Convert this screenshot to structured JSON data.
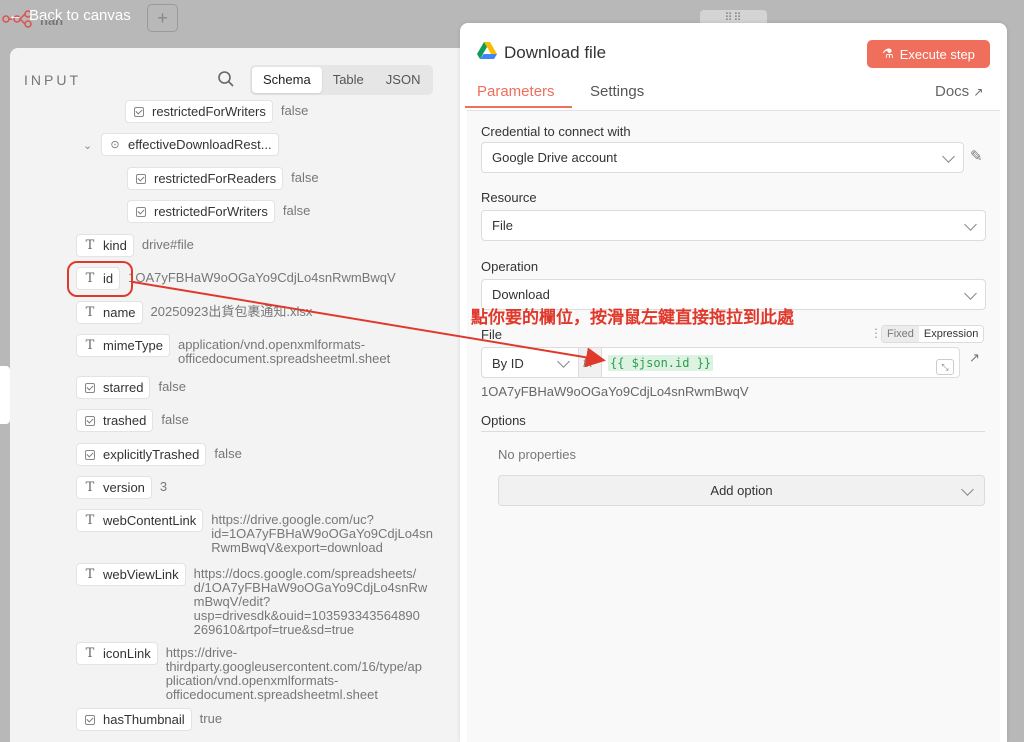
{
  "canvas": {
    "back_label": "Back to canvas",
    "plus_label": "+",
    "bg_label": "nan"
  },
  "input_panel": {
    "title": "INPUT",
    "view_tabs": [
      "Schema",
      "Table",
      "JSON"
    ],
    "active_view": "Schema",
    "rows": [
      {
        "key": "restrictedForWriters",
        "value": "false",
        "type": "boolean"
      },
      {
        "key": "effectiveDownloadRest...",
        "value": "",
        "type": "object"
      },
      {
        "key": "restrictedForReaders",
        "value": "false",
        "type": "boolean"
      },
      {
        "key": "restrictedForWriters",
        "value": "false",
        "type": "boolean"
      },
      {
        "key": "kind",
        "value": "drive#file",
        "type": "string"
      },
      {
        "key": "id",
        "value": "1OA7yFBHaW9oOGaYo9CdjLo4snRwmBwqV",
        "type": "string"
      },
      {
        "key": "name",
        "value": "20250923出貨包裹通知.xlsx",
        "type": "string"
      },
      {
        "key": "mimeType",
        "value": "application/vnd.openxmlformats-officedocument.spreadsheetml.sheet",
        "type": "string"
      },
      {
        "key": "starred",
        "value": "false",
        "type": "boolean"
      },
      {
        "key": "trashed",
        "value": "false",
        "type": "boolean"
      },
      {
        "key": "explicitlyTrashed",
        "value": "false",
        "type": "boolean"
      },
      {
        "key": "version",
        "value": "3",
        "type": "string"
      },
      {
        "key": "webContentLink",
        "value": "https://drive.google.com/uc?id=1OA7yFBHaW9oOGaYo9CdjLo4snRwmBwqV&export=download",
        "type": "string"
      },
      {
        "key": "webViewLink",
        "value": "https://docs.google.com/spreadsheets/d/1OA7yFBHaW9oOGaYo9CdjLo4snRwmBwqV/edit?usp=drivesdk&ouid=103593343564890269610&rtpof=true&sd=true",
        "type": "string"
      },
      {
        "key": "iconLink",
        "value": "https://drive-thirdparty.googleusercontent.com/16/type/application/vnd.openxmlformats-officedocument.spreadsheetml.sheet",
        "type": "string"
      },
      {
        "key": "hasThumbnail",
        "value": "true",
        "type": "boolean"
      }
    ],
    "value_lines": {
      "mimeType": [
        "application/vnd.openxmlformats-",
        "officedocument.spreadsheetml.sheet"
      ],
      "webContentLink": [
        "https://drive.google.com/uc?",
        "id=1OA7yFBHaW9oOGaYo9CdjLo4sn",
        "RwmBwqV&export=download"
      ],
      "webViewLink": [
        "https://docs.google.com/spreadsheets/",
        "d/1OA7yFBHaW9oOGaYo9CdjLo4snRw",
        "mBwqV/edit?",
        "usp=drivesdk&ouid=103593343564890",
        "269610&rtpof=true&sd=true"
      ],
      "iconLink": [
        "https://drive-",
        "thirdparty.googleusercontent.com/16/type/ap",
        "plication/vnd.openxmlformats-",
        "officedocument.spreadsheetml.sheet"
      ]
    }
  },
  "node": {
    "title": "Download file",
    "execute_label": "Execute step",
    "tabs": [
      "Parameters",
      "Settings"
    ],
    "active_tab": "Parameters",
    "docs_label": "Docs",
    "credential_label": "Credential to connect with",
    "credential_value": "Google Drive account",
    "resource_label": "Resource",
    "resource_value": "File",
    "operation_label": "Operation",
    "operation_value": "Download",
    "file_label": "File",
    "mode_fixed": "Fixed",
    "mode_expression": "Expression",
    "by_id_value": "By ID",
    "fx_label": "fx",
    "expression_value": "{{ $json.id }}",
    "result_preview": "1OA7yFBHaW9oOGaYo9CdjLo4snRwmBwqV",
    "options_label": "Options",
    "no_properties": "No properties",
    "add_option_label": "Add option"
  },
  "annotation": {
    "text": "點你要的欄位，按滑鼠左鍵直接拖拉到此處",
    "color": "#e0392b"
  },
  "colors": {
    "accent": "#ef6f5c",
    "expression_green": "#2f9b53"
  }
}
